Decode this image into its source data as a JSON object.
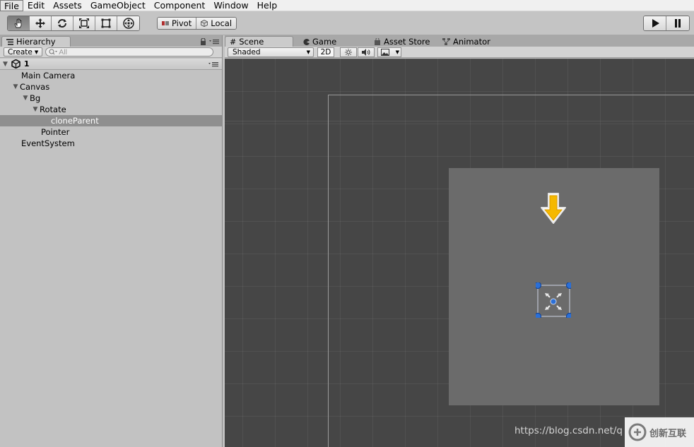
{
  "menu": [
    "File",
    "Edit",
    "Assets",
    "GameObject",
    "Component",
    "Window",
    "Help"
  ],
  "toolbar": {
    "tools": [
      "hand-tool",
      "move-tool",
      "rotate-tool",
      "scale-tool",
      "rect-tool",
      "transform-tool"
    ],
    "active_tool_index": 0,
    "pivot_label": "Pivot",
    "local_label": "Local"
  },
  "hierarchy": {
    "tab_label": "Hierarchy",
    "create_label": "Create",
    "search_placeholder": "All",
    "scene_name": "1",
    "items": [
      {
        "label": "Main Camera",
        "depth": 1,
        "expanded": null
      },
      {
        "label": "Canvas",
        "depth": 1,
        "expanded": true
      },
      {
        "label": "Bg",
        "depth": 2,
        "expanded": true
      },
      {
        "label": "Rotate",
        "depth": 3,
        "expanded": true
      },
      {
        "label": "cloneParent",
        "depth": 4,
        "expanded": null,
        "selected": true
      },
      {
        "label": "Pointer",
        "depth": 3,
        "expanded": null
      },
      {
        "label": "EventSystem",
        "depth": 1,
        "expanded": null
      }
    ]
  },
  "scene": {
    "tabs": [
      "Scene",
      "Game",
      "Asset Store",
      "Animator"
    ],
    "active_tab": "Scene",
    "shading_mode": "Shaded",
    "mode_2d_label": "2D"
  },
  "watermark": {
    "url": "https://blog.csdn.net/q",
    "logo_text": "创新互联"
  },
  "colors": {
    "viewport_bg": "#464646",
    "bg_rect": "#6b6b6b",
    "arrow": "#f5b800",
    "gizmo_handle": "#2b6fd6",
    "selection": "#8f8f8f"
  }
}
